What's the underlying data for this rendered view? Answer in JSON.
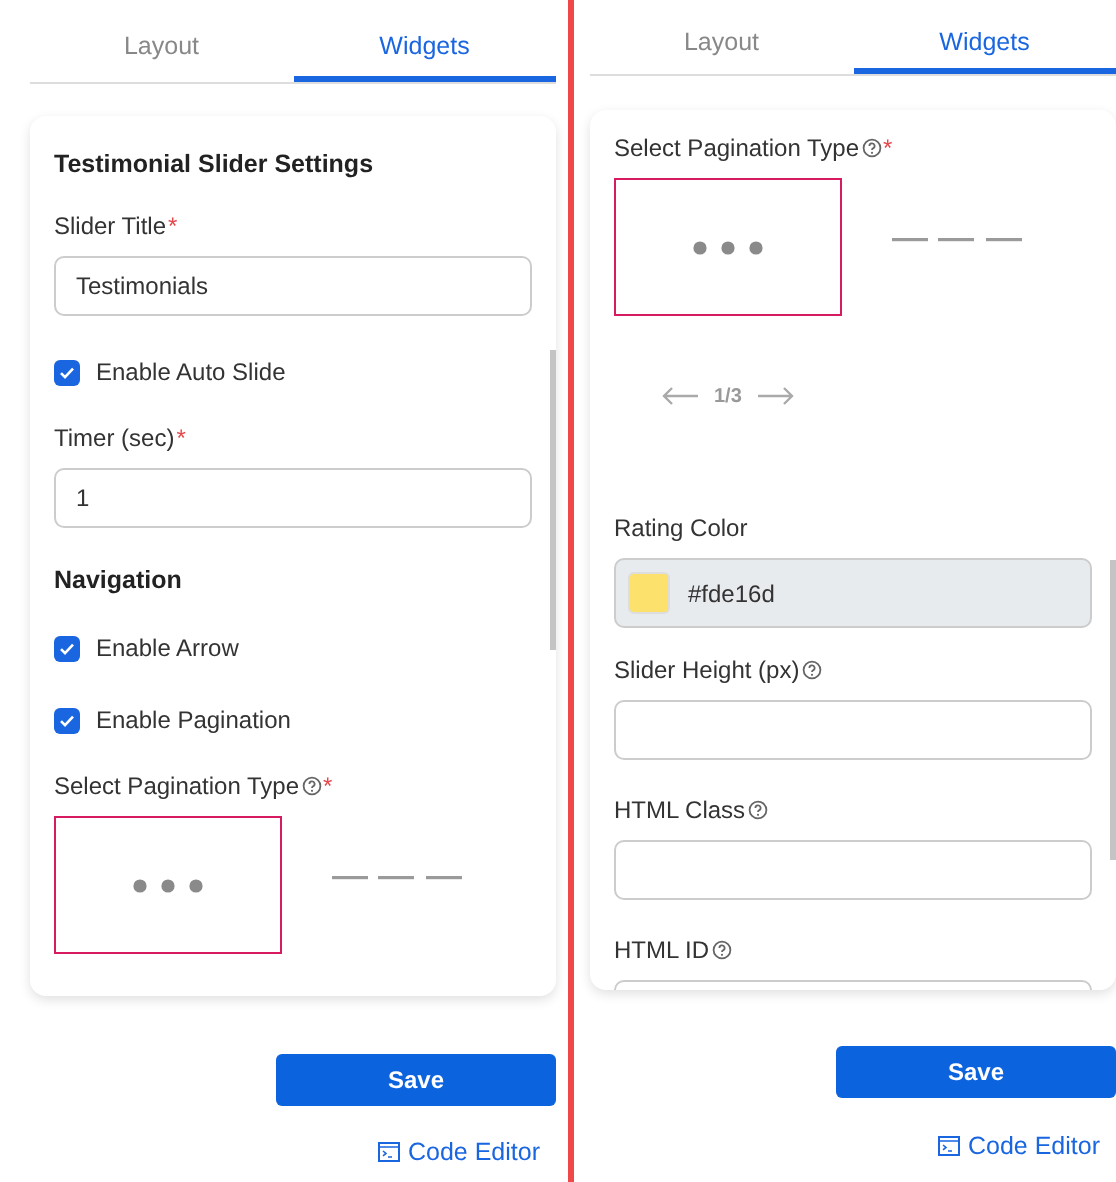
{
  "panels": [
    {
      "tabs": [
        {
          "label": "Layout",
          "selected": false
        },
        {
          "label": "Widgets",
          "selected": true
        }
      ],
      "items": [
        {
          "kind": "heading",
          "text": "Testimonial Slider Settings"
        },
        {
          "kind": "text-field",
          "label": "Slider Title",
          "required_mark": "*",
          "help": false,
          "value": "Testimonials"
        },
        {
          "kind": "checkbox",
          "label": "Enable Auto Slide",
          "checked": true
        },
        {
          "kind": "text-field",
          "label": "Timer (sec)",
          "required_mark": "*",
          "help": false,
          "value": "1"
        },
        {
          "kind": "heading",
          "text": "Navigation"
        },
        {
          "kind": "checkbox",
          "label": "Enable Arrow",
          "checked": true
        },
        {
          "kind": "checkbox",
          "label": "Enable Pagination",
          "checked": true
        },
        {
          "kind": "pagination-picker",
          "label": "Select Pagination Type",
          "required_mark": "*",
          "help": true,
          "options": [
            {
              "kind": "dots",
              "selected": true
            },
            {
              "kind": "dashes",
              "selected": false
            }
          ]
        }
      ],
      "save": "Save",
      "code_editor": "Code Editor"
    },
    {
      "tabs": [
        {
          "label": "Layout",
          "selected": false
        },
        {
          "label": "Widgets",
          "selected": true
        }
      ],
      "items": [
        {
          "kind": "pagination-picker",
          "label": "Select Pagination Type",
          "required_mark": "*",
          "help": true,
          "options": [
            {
              "kind": "dots",
              "selected": true
            },
            {
              "kind": "dashes",
              "selected": false
            }
          ]
        },
        {
          "kind": "pager",
          "text": "1/3"
        },
        {
          "kind": "color-field",
          "label": "Rating Color",
          "value": "#fde16d",
          "color": "#fde16d"
        },
        {
          "kind": "text-field",
          "label": "Slider Height (px)",
          "help": true
        },
        {
          "kind": "text-field",
          "label": "HTML Class",
          "help": true
        },
        {
          "kind": "text-field",
          "label": "HTML ID",
          "help": true
        }
      ],
      "save": "Save",
      "code_editor": "Code Editor"
    }
  ]
}
